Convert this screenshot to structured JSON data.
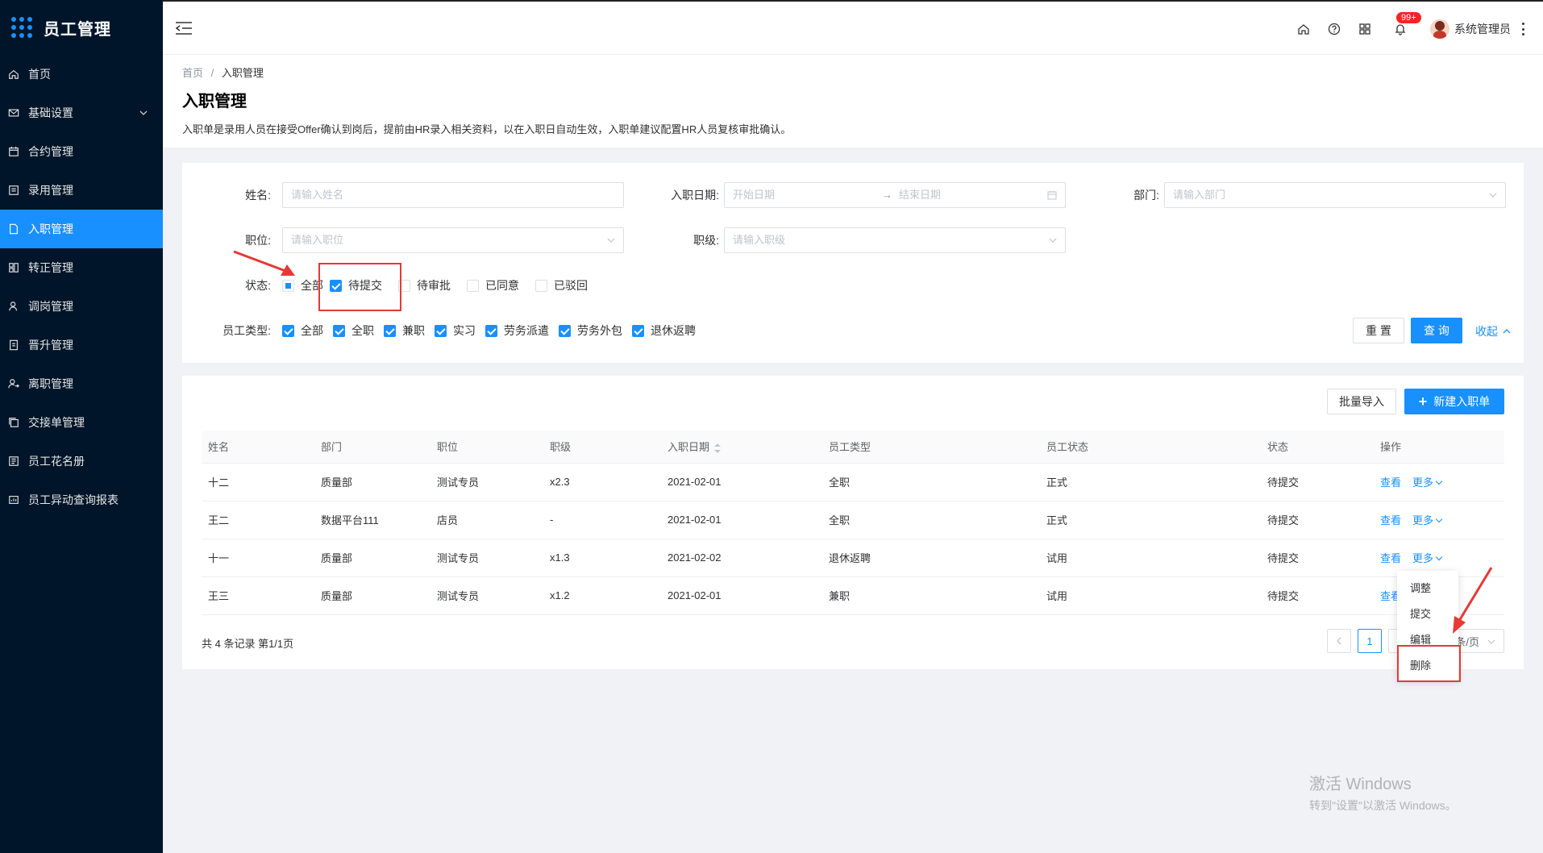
{
  "app": {
    "title": "员工管理"
  },
  "sidebar": {
    "items": [
      {
        "label": "首页",
        "icon": "home-icon"
      },
      {
        "label": "基础设置",
        "icon": "mail-icon",
        "expandable": true
      },
      {
        "label": "合约管理",
        "icon": "calendar-icon"
      },
      {
        "label": "录用管理",
        "icon": "form-icon"
      },
      {
        "label": "入职管理",
        "icon": "file-icon",
        "active": true
      },
      {
        "label": "转正管理",
        "icon": "grid-icon"
      },
      {
        "label": "调岗管理",
        "icon": "user-icon"
      },
      {
        "label": "晋升管理",
        "icon": "doc-icon"
      },
      {
        "label": "离职管理",
        "icon": "exit-icon"
      },
      {
        "label": "交接单管理",
        "icon": "copy-icon"
      },
      {
        "label": "员工花名册",
        "icon": "list-icon"
      },
      {
        "label": "员工异动查询报表",
        "icon": "report-icon"
      }
    ]
  },
  "header": {
    "notification_badge": "99+",
    "username": "系统管理员"
  },
  "breadcrumb": {
    "home": "首页",
    "separator": "/",
    "current": "入职管理"
  },
  "page": {
    "title": "入职管理",
    "description": "入职单是录用人员在接受Offer确认到岗后，提前由HR录入相关资料，以在入职日自动生效，入职单建议配置HR人员复核审批确认。"
  },
  "search": {
    "name_label": "姓名:",
    "name_placeholder": "请输入姓名",
    "date_label": "入职日期:",
    "date_start_placeholder": "开始日期",
    "date_arrow": "→",
    "date_end_placeholder": "结束日期",
    "dept_label": "部门:",
    "dept_placeholder": "请输入部门",
    "position_label": "职位:",
    "position_placeholder": "请输入职位",
    "rank_label": "职级:",
    "rank_placeholder": "请输入职级",
    "status_label": "状态:",
    "status_options": [
      {
        "label": "全部",
        "state": "partial"
      },
      {
        "label": "待提交",
        "state": "checked"
      },
      {
        "label": "待审批",
        "state": "unchecked"
      },
      {
        "label": "已同意",
        "state": "unchecked"
      },
      {
        "label": "已驳回",
        "state": "unchecked"
      }
    ],
    "emp_type_label": "员工类型:",
    "emp_type_options": [
      {
        "label": "全部",
        "state": "checked"
      },
      {
        "label": "全职",
        "state": "checked"
      },
      {
        "label": "兼职",
        "state": "checked"
      },
      {
        "label": "实习",
        "state": "checked"
      },
      {
        "label": "劳务派遣",
        "state": "checked"
      },
      {
        "label": "劳务外包",
        "state": "checked"
      },
      {
        "label": "退休返聘",
        "state": "checked"
      }
    ],
    "reset_label": "重 置",
    "query_label": "查 询",
    "collapse_label": "收起"
  },
  "toolbar": {
    "import_label": "批量导入",
    "new_label": "新建入职单",
    "new_icon": "+"
  },
  "table": {
    "columns": [
      "姓名",
      "部门",
      "职位",
      "职级",
      "入职日期",
      "员工类型",
      "员工状态",
      "状态",
      "操作"
    ],
    "rows": [
      {
        "name": "十二",
        "dept": "质量部",
        "position": "测试专员",
        "rank": "x2.3",
        "date": "2021-02-01",
        "type": "全职",
        "emp_status": "正式",
        "status": "待提交"
      },
      {
        "name": "王二",
        "dept": "数据平台111",
        "position": "店员",
        "rank": "-",
        "date": "2021-02-01",
        "type": "全职",
        "emp_status": "正式",
        "status": "待提交"
      },
      {
        "name": "十一",
        "dept": "质量部",
        "position": "测试专员",
        "rank": "x1.3",
        "date": "2021-02-02",
        "type": "退休返聘",
        "emp_status": "试用",
        "status": "待提交"
      },
      {
        "name": "王三",
        "dept": "质量部",
        "position": "测试专员",
        "rank": "x1.2",
        "date": "2021-02-01",
        "type": "兼职",
        "emp_status": "试用",
        "status": "待提交"
      }
    ],
    "view_label": "查看",
    "more_label": "更多"
  },
  "pagination": {
    "summary": "共 4 条记录 第1/1页",
    "current_page": "1",
    "page_size_label": "0 条/页"
  },
  "dropdown": {
    "items": [
      "调整",
      "提交",
      "编辑",
      "删除"
    ]
  },
  "watermark": {
    "line1": "激活 Windows",
    "line2": "转到\"设置\"以激活 Windows。"
  },
  "colors": {
    "primary": "#1890ff",
    "sidebar_bg": "#001529",
    "highlight": "#e53935"
  }
}
